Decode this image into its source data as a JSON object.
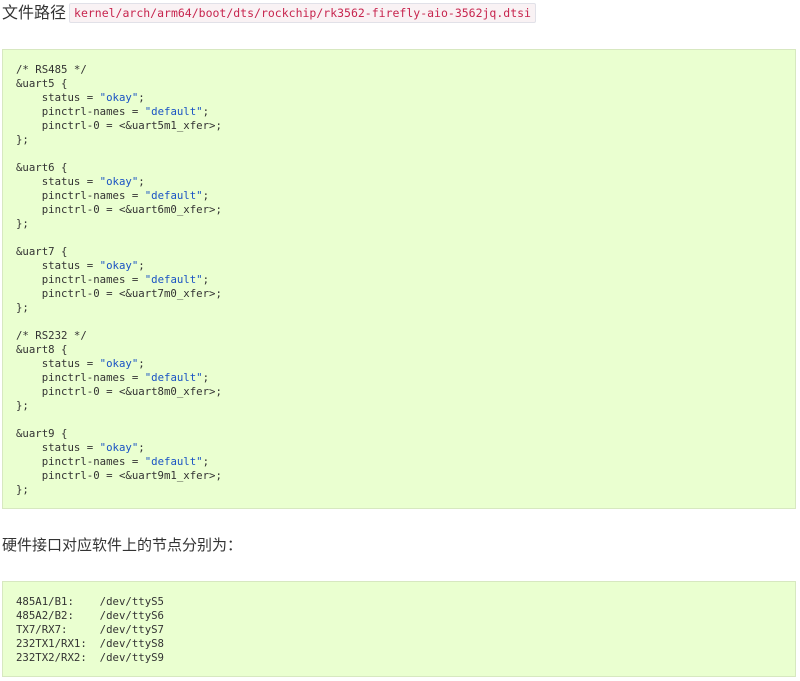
{
  "file_path": {
    "label": "文件路径",
    "path": "kernel/arch/arm64/boot/dts/rockchip/rk3562-firefly-aio-3562jq.dtsi"
  },
  "dts_code": [
    {
      "pre": "/* RS485 */",
      "str": "",
      "post": ""
    },
    {
      "pre": "&uart5 {",
      "str": "",
      "post": ""
    },
    {
      "pre": "    status = ",
      "str": "\"okay\"",
      "post": ";"
    },
    {
      "pre": "    pinctrl-names = ",
      "str": "\"default\"",
      "post": ";"
    },
    {
      "pre": "    pinctrl-0 = <&uart5m1_xfer>;",
      "str": "",
      "post": ""
    },
    {
      "pre": "};",
      "str": "",
      "post": ""
    },
    {
      "pre": "",
      "str": "",
      "post": ""
    },
    {
      "pre": "&uart6 {",
      "str": "",
      "post": ""
    },
    {
      "pre": "    status = ",
      "str": "\"okay\"",
      "post": ";"
    },
    {
      "pre": "    pinctrl-names = ",
      "str": "\"default\"",
      "post": ";"
    },
    {
      "pre": "    pinctrl-0 = <&uart6m0_xfer>;",
      "str": "",
      "post": ""
    },
    {
      "pre": "};",
      "str": "",
      "post": ""
    },
    {
      "pre": "",
      "str": "",
      "post": ""
    },
    {
      "pre": "&uart7 {",
      "str": "",
      "post": ""
    },
    {
      "pre": "    status = ",
      "str": "\"okay\"",
      "post": ";"
    },
    {
      "pre": "    pinctrl-names = ",
      "str": "\"default\"",
      "post": ";"
    },
    {
      "pre": "    pinctrl-0 = <&uart7m0_xfer>;",
      "str": "",
      "post": ""
    },
    {
      "pre": "};",
      "str": "",
      "post": ""
    },
    {
      "pre": "",
      "str": "",
      "post": ""
    },
    {
      "pre": "/* RS232 */",
      "str": "",
      "post": ""
    },
    {
      "pre": "&uart8 {",
      "str": "",
      "post": ""
    },
    {
      "pre": "    status = ",
      "str": "\"okay\"",
      "post": ";"
    },
    {
      "pre": "    pinctrl-names = ",
      "str": "\"default\"",
      "post": ";"
    },
    {
      "pre": "    pinctrl-0 = <&uart8m0_xfer>;",
      "str": "",
      "post": ""
    },
    {
      "pre": "};",
      "str": "",
      "post": ""
    },
    {
      "pre": "",
      "str": "",
      "post": ""
    },
    {
      "pre": "&uart9 {",
      "str": "",
      "post": ""
    },
    {
      "pre": "    status = ",
      "str": "\"okay\"",
      "post": ";"
    },
    {
      "pre": "    pinctrl-names = ",
      "str": "\"default\"",
      "post": ";"
    },
    {
      "pre": "    pinctrl-0 = <&uart9m1_xfer>;",
      "str": "",
      "post": ""
    },
    {
      "pre": "};",
      "str": "",
      "post": ""
    }
  ],
  "mapping_intro": "硬件接口对应软件上的节点分别为：",
  "mapping_code": [
    "485A1/B1:    /dev/ttyS5",
    "485A2/B2:    /dev/ttyS6",
    "TX7/RX7:     /dev/ttyS7",
    "232TX1/RX1:  /dev/ttyS8",
    "232TX2/RX2:  /dev/ttyS9"
  ],
  "colors": {
    "code_background": "#eaffd0",
    "string_color": "#1a53c4",
    "inline_code_color": "#c7254e"
  }
}
